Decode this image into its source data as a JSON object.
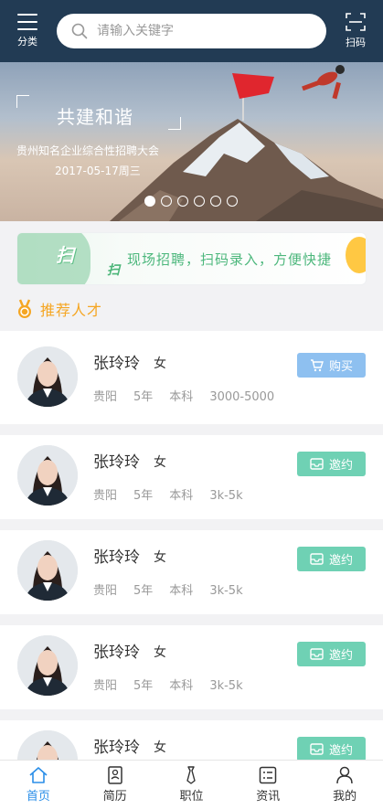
{
  "header": {
    "menu_label": "分类",
    "search_placeholder": "请输入关键字",
    "scan_label": "扫码"
  },
  "banner": {
    "title": "共建和谐",
    "subtitle": "贵州知名企业综合性招聘大会",
    "date": "2017-05-17周三",
    "slide_count": 6,
    "active_slide": 1
  },
  "promo": {
    "scan_word_1": "扫",
    "scan_word_2": "扫",
    "text": "现场招聘，扫码录入，方便快捷"
  },
  "section": {
    "title": "推荐人才"
  },
  "candidates": [
    {
      "name": "张玲玲",
      "gender": "女",
      "city": "贵阳",
      "years": "5年",
      "degree": "本科",
      "salary": "3000-5000",
      "action": "购买",
      "action_type": "buy"
    },
    {
      "name": "张玲玲",
      "gender": "女",
      "city": "贵阳",
      "years": "5年",
      "degree": "本科",
      "salary": "3k-5k",
      "action": "邀约",
      "action_type": "invite"
    },
    {
      "name": "张玲玲",
      "gender": "女",
      "city": "贵阳",
      "years": "5年",
      "degree": "本科",
      "salary": "3k-5k",
      "action": "邀约",
      "action_type": "invite"
    },
    {
      "name": "张玲玲",
      "gender": "女",
      "city": "贵阳",
      "years": "5年",
      "degree": "本科",
      "salary": "3k-5k",
      "action": "邀约",
      "action_type": "invite"
    },
    {
      "name": "张玲玲",
      "gender": "女",
      "city": "",
      "years": "",
      "degree": "",
      "salary": "",
      "action": "邀约",
      "action_type": "invite"
    }
  ],
  "tabs": [
    {
      "label": "首页",
      "icon": "home-icon",
      "active": true
    },
    {
      "label": "简历",
      "icon": "resume-icon",
      "active": false
    },
    {
      "label": "职位",
      "icon": "tie-icon",
      "active": false
    },
    {
      "label": "资讯",
      "icon": "news-icon",
      "active": false
    },
    {
      "label": "我的",
      "icon": "user-icon",
      "active": false
    }
  ],
  "colors": {
    "header_bg": "#223b54",
    "accent_orange": "#f5a623",
    "buy_button": "#8ec0f0",
    "invite_button": "#6fd1b4",
    "active_tab": "#2a8ee8"
  }
}
